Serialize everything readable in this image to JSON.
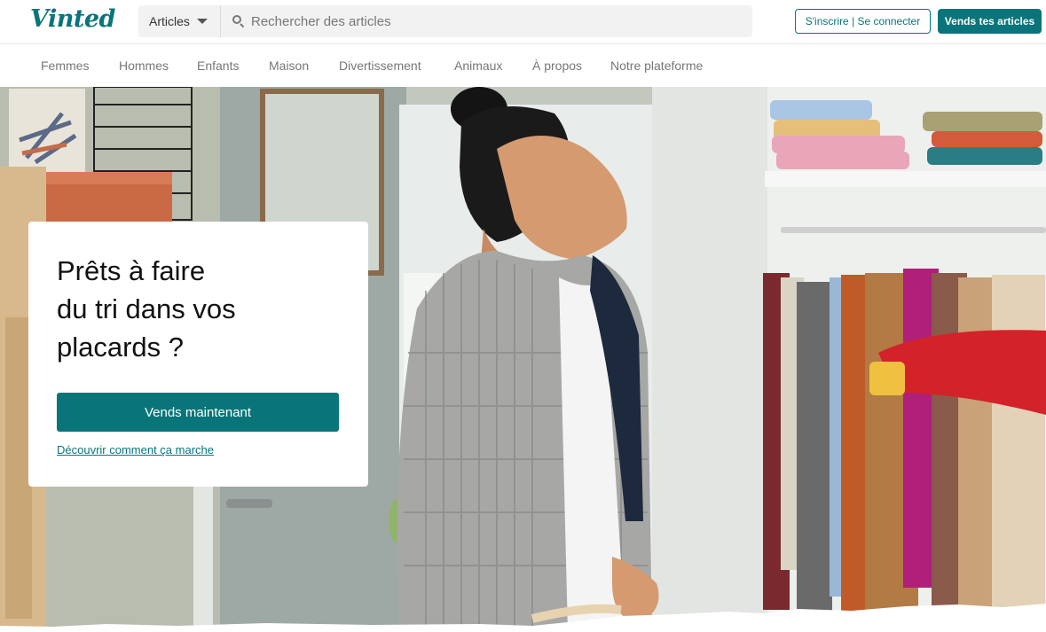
{
  "header": {
    "logo": "Vinted",
    "category_select": "Articles",
    "search_placeholder": "Rechercher des articles",
    "login_label": "S'inscrire | Se connecter",
    "sell_label": "Vends tes articles"
  },
  "nav": {
    "items": [
      "Femmes",
      "Hommes",
      "Enfants",
      "Maison",
      "Divertissement",
      "Animaux",
      "À propos",
      "Notre plateforme"
    ]
  },
  "hero": {
    "title_lines": [
      "Prêts à faire",
      "du tri dans vos",
      "placards ?"
    ],
    "cta_label": "Vends maintenant",
    "link_label": "Découvrir comment ça marche"
  },
  "colors": {
    "brand": "#09757a",
    "nav_text": "#777777",
    "search_bg": "#f2f2f2"
  },
  "icons": {
    "search": "search-icon",
    "caret": "chevron-down-icon"
  }
}
